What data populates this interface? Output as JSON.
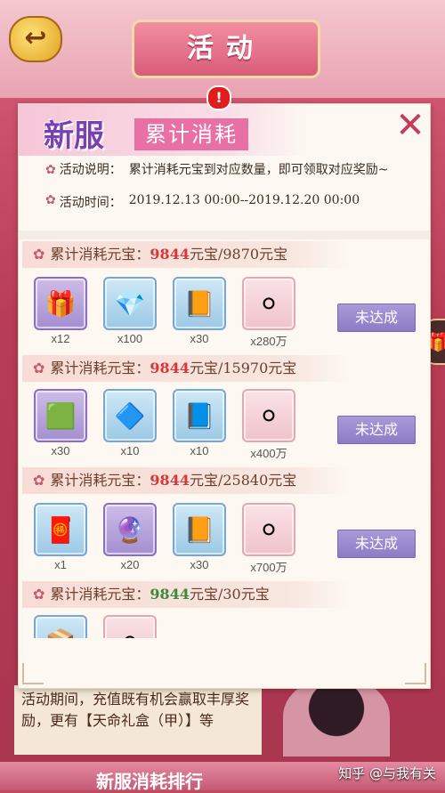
{
  "background": {
    "page_title": "活动",
    "alert_badge": "!",
    "back_icon": "back-arrow-icon",
    "description_text": "活动期间，充值既有机会赢取丰厚奖励，更有【天命礼盒（甲）】等",
    "bottom_title": "新服消耗排行",
    "watermark": "知乎 @与我有关",
    "gift_icon": "gift-icon"
  },
  "dialog": {
    "title_main": "新服",
    "title_sub": "累计消耗",
    "close_icon": "close-x-icon",
    "info": {
      "desc_label": "活动说明：",
      "desc_value": "累计消耗元宝到对应数量，即可领取对应奖励~",
      "time_label": "活动时间：",
      "time_value": "2019.12.13 00:00--2019.12.20 00:00"
    },
    "tiers": [
      {
        "label": "累计消耗元宝：",
        "current": "9844",
        "target": "元宝/9870元宝",
        "status": "未达成",
        "items": [
          {
            "icon": "treasure-chest-icon",
            "qty": "x12",
            "frame": "purple"
          },
          {
            "icon": "blue-gems-icon",
            "qty": "x100",
            "frame": "blue"
          },
          {
            "icon": "book-scroll-icon",
            "qty": "x30",
            "frame": "blue"
          },
          {
            "icon": "silver-coin-icon",
            "qty": "x280万",
            "frame": "pink"
          }
        ]
      },
      {
        "label": "累计消耗元宝：",
        "current": "9844",
        "target": "元宝/15970元宝",
        "status": "未达成",
        "items": [
          {
            "icon": "green-jade-icon",
            "qty": "x30",
            "frame": "purple"
          },
          {
            "icon": "blue-crystal-icon",
            "qty": "x10",
            "frame": "blue"
          },
          {
            "icon": "dark-book-icon",
            "qty": "x10",
            "frame": "blue"
          },
          {
            "icon": "silver-coin-icon",
            "qty": "x400万",
            "frame": "pink"
          }
        ]
      },
      {
        "label": "累计消耗元宝：",
        "current": "9844",
        "target": "元宝/25840元宝",
        "status": "未达成",
        "items": [
          {
            "icon": "red-gift-box-icon",
            "qty": "x1",
            "frame": "blue"
          },
          {
            "icon": "purple-crystal-icon",
            "qty": "x20",
            "frame": "purple"
          },
          {
            "icon": "book-scroll-icon",
            "qty": "x30",
            "frame": "blue"
          },
          {
            "icon": "silver-coin-icon",
            "qty": "x700万",
            "frame": "pink"
          }
        ]
      },
      {
        "label": "累计消耗元宝：",
        "current": "9844",
        "target": "元宝/30元宝",
        "items": [
          {
            "icon": "partial-item-icon",
            "qty": "",
            "frame": "blue"
          },
          {
            "icon": "silver-coin-icon",
            "qty": "",
            "frame": "pink"
          }
        ]
      }
    ]
  }
}
